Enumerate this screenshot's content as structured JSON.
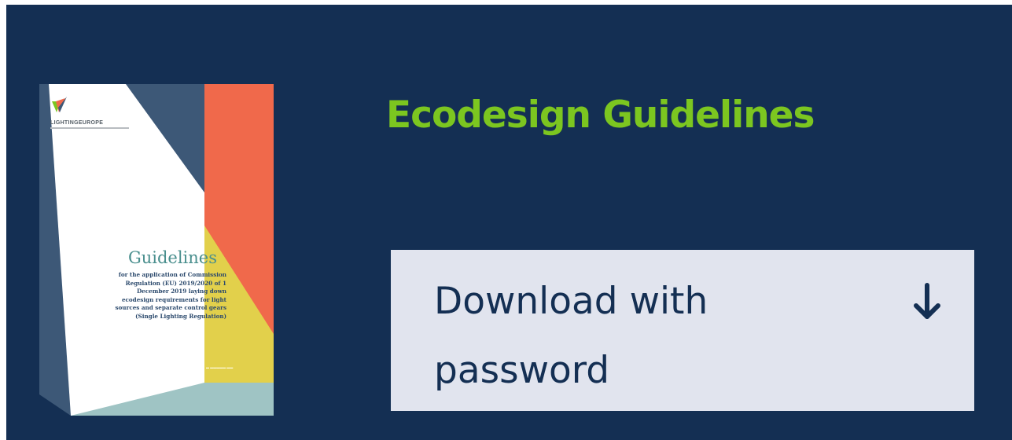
{
  "card": {
    "title": "Ecodesign Guidelines",
    "download": {
      "label": "Download with password",
      "icon": "arrow-down-icon"
    }
  },
  "cover": {
    "brand": "LIGHTINGEUROPE",
    "heading": "Guidelines",
    "subheading": "for the application of Commission Regulation (EU) 2019/2020 of 1 December 2019 laying down ecodesign requirements for light sources and separate control gears (Single Lighting Regulation)",
    "colors": {
      "navy": "#142f53",
      "slate": "#3d5877",
      "orange": "#f0694b",
      "yellow": "#e2d04b",
      "teal": "#9fc4c4",
      "white": "#ffffff"
    }
  },
  "colors": {
    "background": "#142f53",
    "title": "#7cc620",
    "button_bg": "#e1e4ee",
    "button_text": "#142f53"
  }
}
